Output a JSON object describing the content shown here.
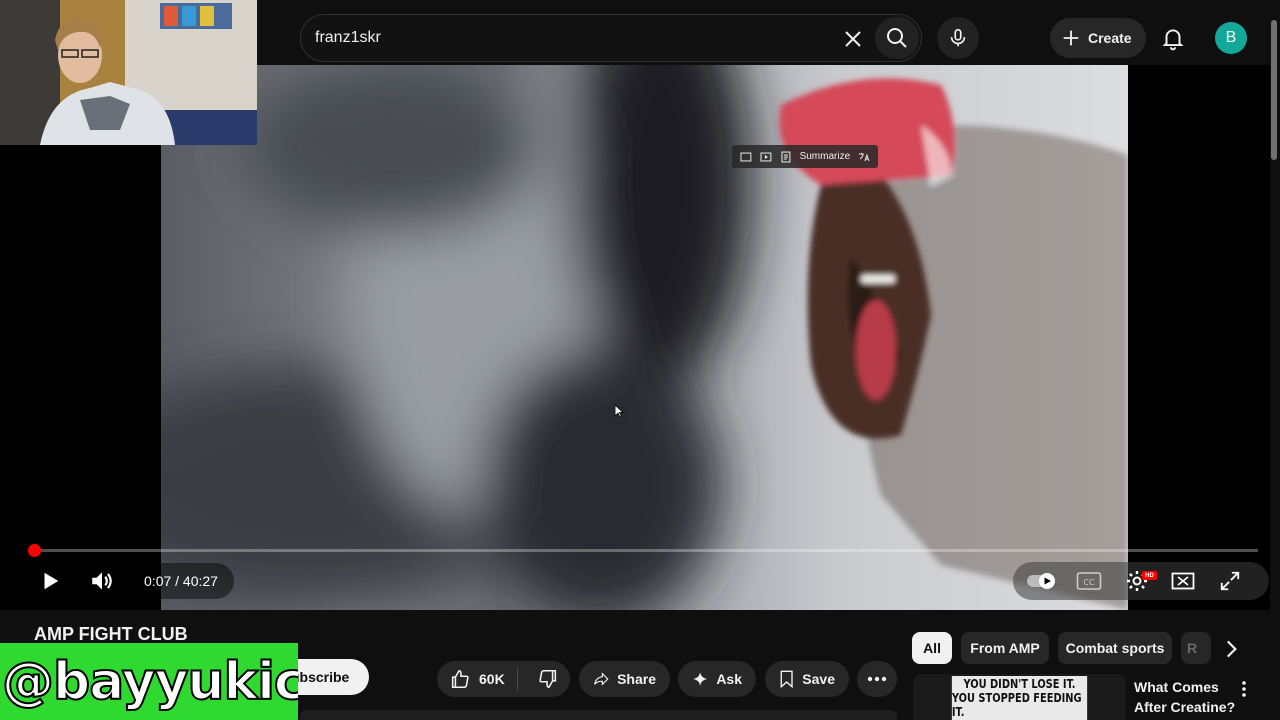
{
  "search": {
    "query": "franz1skr"
  },
  "header": {
    "create_label": "Create",
    "avatar_letter": "B"
  },
  "player": {
    "ai_toolbar": {
      "summarize_label": "Summarize"
    },
    "time_display": "0:07 / 40:27",
    "progress": {
      "current_seconds": 7,
      "duration_seconds": 2427
    },
    "hd_badge": "HD"
  },
  "channel": {
    "name": "AMP FIGHT CLUB",
    "subscribe_label": "Subscribe"
  },
  "overlay_handle": "@bayyukich",
  "actions": {
    "like_count": "60K",
    "share_label": "Share",
    "ask_label": "Ask",
    "save_label": "Save"
  },
  "chips": {
    "all": "All",
    "from_amp": "From AMP",
    "combat_sports": "Combat sports",
    "partial": "R"
  },
  "recommended": {
    "thumbnail_line1": "YOU DIDN'T LOSE IT.",
    "thumbnail_line2": "YOU STOPPED FEEDING IT.",
    "title": "What Comes After Creatine?"
  },
  "colors": {
    "background": "#0f0f0f",
    "progress_red": "#ff0000",
    "avatar": "#12a89a",
    "overlay_green": "#2fd92f"
  },
  "icons": [
    "clear-icon",
    "search-icon",
    "mic-icon",
    "plus-icon",
    "bell-icon",
    "play-icon",
    "volume-icon",
    "autoplay-toggle-icon",
    "cc-icon",
    "settings-icon",
    "theater-icon",
    "fullscreen-icon",
    "like-icon",
    "dislike-icon",
    "share-icon",
    "sparkle-icon",
    "bookmark-icon",
    "more-horizontal-icon",
    "chevron-right-icon",
    "more-vertical-icon"
  ]
}
